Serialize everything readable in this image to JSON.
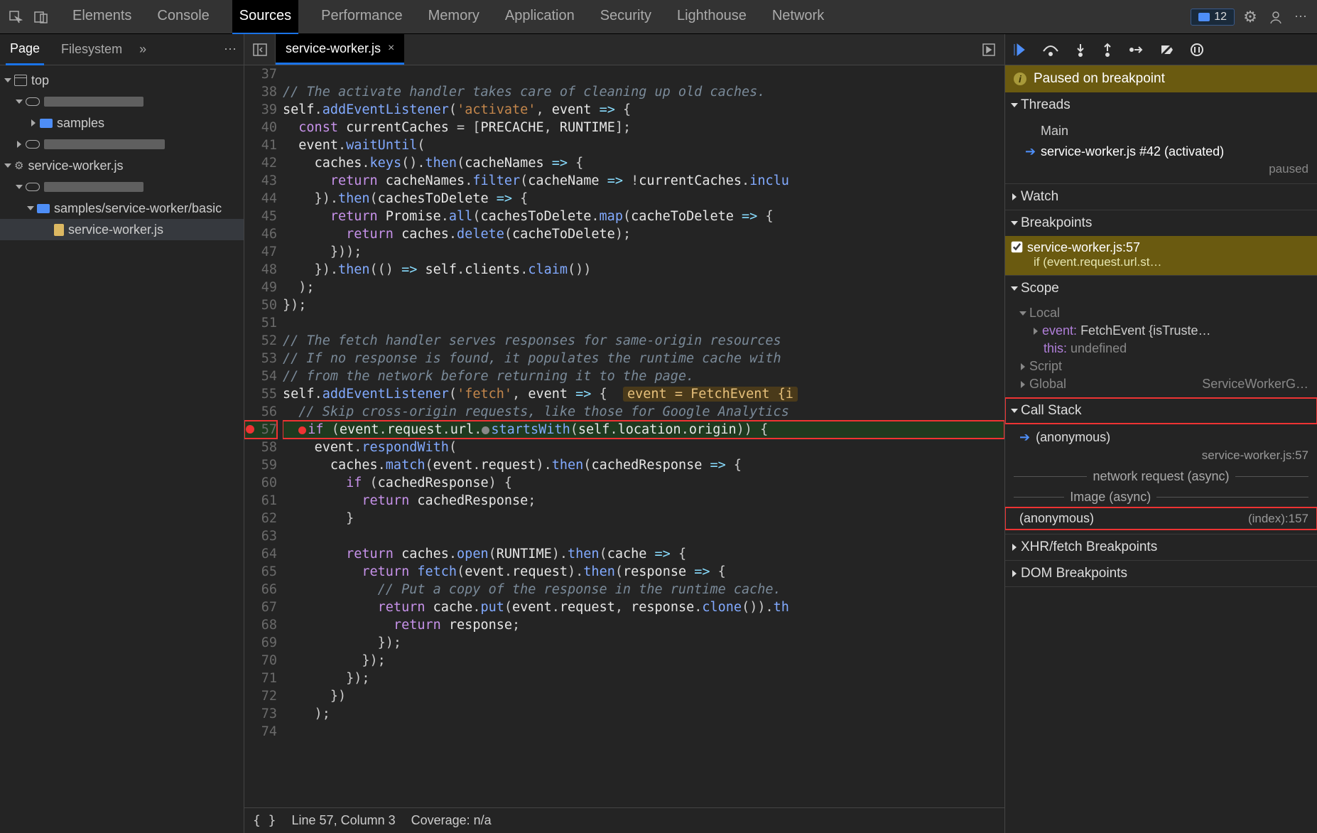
{
  "topbar": {
    "tabs": [
      "Elements",
      "Console",
      "Sources",
      "Performance",
      "Memory",
      "Application",
      "Security",
      "Lighthouse",
      "Network"
    ],
    "active_tab": "Sources",
    "issues_count": "12"
  },
  "nav": {
    "tabs": {
      "page": "Page",
      "filesystem": "Filesystem"
    },
    "tree": {
      "top": "top",
      "samples": "samples",
      "sw_root": "service-worker.js",
      "path_folder": "samples/service-worker/basic",
      "file": "service-worker.js"
    }
  },
  "editor": {
    "tab": "service-worker.js",
    "status": {
      "pos": "Line 57, Column 3",
      "coverage": "Coverage: n/a"
    },
    "lines": [
      {
        "n": 37,
        "html": ""
      },
      {
        "n": 38,
        "html": "<span class='cm'>// The activate handler takes care of cleaning up old caches.</span>"
      },
      {
        "n": 39,
        "html": "<span class='id'>self</span>.<span class='fn'>addEventListener</span>(<span class='str'>'activate'</span>, <span class='id'>event</span> <span class='op'>=&gt;</span> {"
      },
      {
        "n": 40,
        "html": "  <span class='kw'>const</span> <span class='id'>currentCaches</span> = [<span class='id'>PRECACHE</span>, <span class='id'>RUNTIME</span>];"
      },
      {
        "n": 41,
        "html": "  <span class='id'>event</span>.<span class='fn'>waitUntil</span>("
      },
      {
        "n": 42,
        "html": "    <span class='id'>caches</span>.<span class='fn'>keys</span>().<span class='fn'>then</span>(<span class='id'>cacheNames</span> <span class='op'>=&gt;</span> {"
      },
      {
        "n": 43,
        "html": "      <span class='kw'>return</span> <span class='id'>cacheNames</span>.<span class='fn'>filter</span>(<span class='id'>cacheName</span> <span class='op'>=&gt;</span> !<span class='id'>currentCaches</span>.<span class='fn'>inclu</span>"
      },
      {
        "n": 44,
        "html": "    }).<span class='fn'>then</span>(<span class='id'>cachesToDelete</span> <span class='op'>=&gt;</span> {"
      },
      {
        "n": 45,
        "html": "      <span class='kw'>return</span> <span class='id'>Promise</span>.<span class='fn'>all</span>(<span class='id'>cachesToDelete</span>.<span class='fn'>map</span>(<span class='id'>cacheToDelete</span> <span class='op'>=&gt;</span> {"
      },
      {
        "n": 46,
        "html": "        <span class='kw'>return</span> <span class='id'>caches</span>.<span class='fn'>delete</span>(<span class='id'>cacheToDelete</span>);"
      },
      {
        "n": 47,
        "html": "      }));"
      },
      {
        "n": 48,
        "html": "    }).<span class='fn'>then</span>(() <span class='op'>=&gt;</span> <span class='id'>self</span>.<span class='id'>clients</span>.<span class='fn'>claim</span>())"
      },
      {
        "n": 49,
        "html": "  );"
      },
      {
        "n": 50,
        "html": "});"
      },
      {
        "n": 51,
        "html": ""
      },
      {
        "n": 52,
        "html": "<span class='cm'>// The fetch handler serves responses for same-origin resources </span>"
      },
      {
        "n": 53,
        "html": "<span class='cm'>// If no response is found, it populates the runtime cache with </span>"
      },
      {
        "n": 54,
        "html": "<span class='cm'>// from the network before returning it to the page.</span>"
      },
      {
        "n": 55,
        "html": "<span class='id'>self</span>.<span class='fn'>addEventListener</span>(<span class='str'>'fetch'</span>, <span class='id'>event</span> <span class='op'>=&gt;</span> {  <span class='ev-badge'>event = FetchEvent {i</span>"
      },
      {
        "n": 56,
        "html": "  <span class='cm'>// Skip cross-origin requests, like those for Google Analytics</span>"
      },
      {
        "n": 57,
        "exec": true,
        "html": "  <span class='red-dot'></span><span class='kw'>if</span> (<span class='id'>event</span>.<span class='id'>request</span>.<span class='id'>url</span>.<span class='gray-dot'></span><span class='fn'>startsWith</span>(<span class='id'>self</span>.<span class='id'>location</span>.<span class='id'>origin</span>)) {"
      },
      {
        "n": 58,
        "html": "    <span class='id'>event</span>.<span class='fn'>respondWith</span>("
      },
      {
        "n": 59,
        "html": "      <span class='id'>caches</span>.<span class='fn'>match</span>(<span class='id'>event</span>.<span class='id'>request</span>).<span class='fn'>then</span>(<span class='id'>cachedResponse</span> <span class='op'>=&gt;</span> {"
      },
      {
        "n": 60,
        "html": "        <span class='kw'>if</span> (<span class='id'>cachedResponse</span>) {"
      },
      {
        "n": 61,
        "html": "          <span class='kw'>return</span> <span class='id'>cachedResponse</span>;"
      },
      {
        "n": 62,
        "html": "        }"
      },
      {
        "n": 63,
        "html": ""
      },
      {
        "n": 64,
        "html": "        <span class='kw'>return</span> <span class='id'>caches</span>.<span class='fn'>open</span>(<span class='id'>RUNTIME</span>).<span class='fn'>then</span>(<span class='id'>cache</span> <span class='op'>=&gt;</span> {"
      },
      {
        "n": 65,
        "html": "          <span class='kw'>return</span> <span class='fn'>fetch</span>(<span class='id'>event</span>.<span class='id'>request</span>).<span class='fn'>then</span>(<span class='id'>response</span> <span class='op'>=&gt;</span> {"
      },
      {
        "n": 66,
        "html": "            <span class='cm'>// Put a copy of the response in the runtime cache.</span>"
      },
      {
        "n": 67,
        "html": "            <span class='kw'>return</span> <span class='id'>cache</span>.<span class='fn'>put</span>(<span class='id'>event</span>.<span class='id'>request</span>, <span class='id'>response</span>.<span class='fn'>clone</span>()).<span class='fn'>th</span>"
      },
      {
        "n": 68,
        "html": "              <span class='kw'>return</span> <span class='id'>response</span>;"
      },
      {
        "n": 69,
        "html": "            });"
      },
      {
        "n": 70,
        "html": "          });"
      },
      {
        "n": 71,
        "html": "        });"
      },
      {
        "n": 72,
        "html": "      })"
      },
      {
        "n": 73,
        "html": "    );"
      },
      {
        "n": 74,
        "html": ""
      }
    ]
  },
  "debug": {
    "paused": "Paused on breakpoint",
    "threads": {
      "title": "Threads",
      "main": "Main",
      "sw": "service-worker.js #42 (activated)",
      "sw_status": "paused"
    },
    "watch": "Watch",
    "breakpoints": {
      "title": "Breakpoints",
      "label": "service-worker.js:57",
      "snip": "if (event.request.url.st…"
    },
    "scope": {
      "title": "Scope",
      "local": "Local",
      "event_k": "event:",
      "event_v": "FetchEvent {isTruste…",
      "this_k": "this:",
      "this_v": "undefined",
      "script": "Script",
      "global": "Global",
      "global_v": "ServiceWorkerG…"
    },
    "callstack": {
      "title": "Call Stack",
      "f0": "(anonymous)",
      "f0_loc": "service-worker.js:57",
      "sep1": "network request (async)",
      "sep2": "Image (async)",
      "f1": "(anonymous)",
      "f1_loc": "(index):157"
    },
    "xhr": "XHR/fetch Breakpoints",
    "dom": "DOM Breakpoints"
  }
}
